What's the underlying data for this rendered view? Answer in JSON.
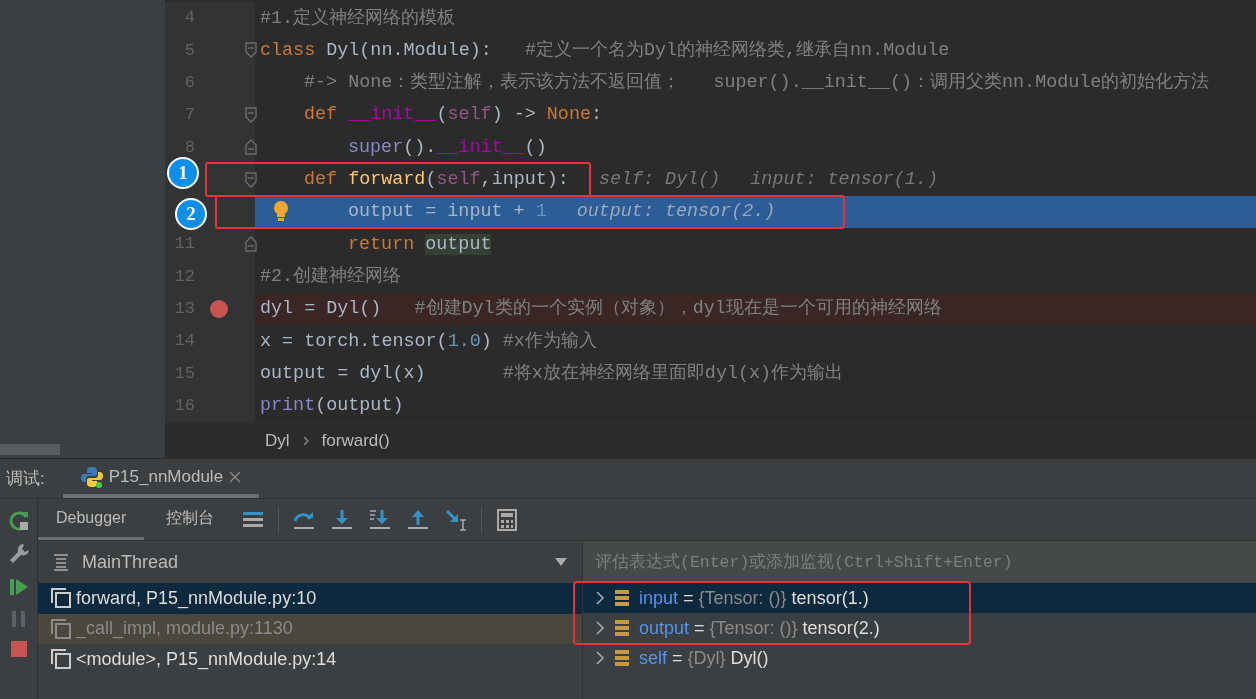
{
  "editor": {
    "lines": [
      {
        "number": "4",
        "kind": "outer",
        "current": false,
        "breakpoint": false,
        "fold_start": false,
        "fold_end": false,
        "tokens": [
          {
            "kind": "comment",
            "text": "#1.定义神经网络的模板"
          }
        ]
      },
      {
        "number": "5",
        "kind": "outer",
        "current": false,
        "breakpoint": false,
        "fold_start": true,
        "fold_end": false,
        "tokens": [
          {
            "kind": "keyword",
            "text": "class"
          },
          {
            "kind": "plain",
            "text": " Dyl(nn.Module):   "
          },
          {
            "kind": "comment",
            "text": "#定义一个名为Dyl的神经网络类,继承自nn.Module"
          }
        ]
      },
      {
        "number": "6",
        "kind": "inner",
        "current": false,
        "breakpoint": false,
        "fold_start": false,
        "fold_end": false,
        "tokens": [
          {
            "kind": "comment",
            "text": "#-> None：类型注解，表示该方法不返回值；   super().__init__()：调用父类nn.Module的初始化方法"
          }
        ]
      },
      {
        "number": "7",
        "kind": "inner",
        "current": false,
        "breakpoint": false,
        "fold_start": true,
        "fold_end": false,
        "tokens": [
          {
            "kind": "keyword",
            "text": "def"
          },
          {
            "kind": "magic",
            "text": " __init__"
          },
          {
            "kind": "plain",
            "text": "("
          },
          {
            "kind": "self",
            "text": "self"
          },
          {
            "kind": "plain",
            "text": ") -> "
          },
          {
            "kind": "keyword",
            "text": "None"
          },
          {
            "kind": "plain",
            "text": ":"
          }
        ]
      },
      {
        "number": "8",
        "kind": "innermost",
        "current": false,
        "breakpoint": false,
        "fold_start": false,
        "fold_end": true,
        "tokens": [
          {
            "kind": "builtin",
            "text": "super"
          },
          {
            "kind": "plain",
            "text": "()."
          },
          {
            "kind": "magic",
            "text": "__init__"
          },
          {
            "kind": "plain",
            "text": "()"
          }
        ]
      },
      {
        "kind": "inner",
        "current": false,
        "breakpoint": false,
        "fold_start": true,
        "fold_end": false,
        "badge": "1",
        "tokens": [
          {
            "kind": "keyword",
            "text": "def"
          },
          {
            "kind": "function",
            "text": " forward"
          },
          {
            "kind": "plain",
            "text": "("
          },
          {
            "kind": "self",
            "text": "self"
          },
          {
            "kind": "plain",
            "text": ",input):"
          }
        ],
        "hints": [
          "self: Dyl()",
          "input: tensor(1.)"
        ]
      },
      {
        "kind": "innermost",
        "current": true,
        "breakpoint": false,
        "fold_start": false,
        "fold_end": false,
        "bulb": true,
        "badge": "2",
        "tokens": [
          {
            "kind": "plain",
            "text": "output = input + "
          },
          {
            "kind": "number",
            "text": "1"
          }
        ],
        "hints": [
          "output: tensor(2.)"
        ]
      },
      {
        "number": "11",
        "kind": "innermost",
        "current": false,
        "breakpoint": false,
        "fold_start": false,
        "fold_end": true,
        "tokens": [
          {
            "kind": "keyword",
            "text": "return "
          },
          {
            "kind": "usage",
            "text": "output"
          }
        ]
      },
      {
        "number": "12",
        "kind": "outer",
        "current": false,
        "breakpoint": false,
        "fold_start": false,
        "fold_end": false,
        "tokens": [
          {
            "kind": "comment",
            "text": "#2.创建神经网络"
          }
        ]
      },
      {
        "number": "13",
        "kind": "outer",
        "current": false,
        "breakpoint": true,
        "fold_start": false,
        "fold_end": false,
        "tokens": [
          {
            "kind": "plain",
            "text": "dyl = Dyl()   "
          },
          {
            "kind": "comment",
            "text": "#创建Dyl类的一个实例（对象），dyl现在是一个可用的神经网络"
          }
        ]
      },
      {
        "number": "14",
        "kind": "outer",
        "current": false,
        "breakpoint": false,
        "fold_start": false,
        "fold_end": false,
        "tokens": [
          {
            "kind": "plain",
            "text": "x = torch.tensor("
          },
          {
            "kind": "number",
            "text": "1.0"
          },
          {
            "kind": "plain",
            "text": ")"
          },
          {
            "kind": "comment",
            "text": " #x作为输入"
          }
        ]
      },
      {
        "number": "15",
        "kind": "outer",
        "current": false,
        "breakpoint": false,
        "fold_start": false,
        "fold_end": false,
        "tokens": [
          {
            "kind": "plain",
            "text": "output = dyl(x)       "
          },
          {
            "kind": "comment",
            "text": "#将x放在神经网络里面即dyl(x)作为输出"
          }
        ]
      },
      {
        "number": "16",
        "kind": "outer",
        "current": false,
        "breakpoint": false,
        "fold_start": false,
        "fold_end": false,
        "tokens": [
          {
            "kind": "builtin",
            "text": "print"
          },
          {
            "kind": "plain",
            "text": "(output)"
          }
        ]
      }
    ],
    "breadcrumb": [
      "Dyl",
      "forward()"
    ]
  },
  "debug": {
    "label": "调试:",
    "session_tab": "P15_nnModule",
    "tabs": [
      {
        "label": "Debugger",
        "selected": true
      },
      {
        "label": "控制台",
        "selected": false
      }
    ],
    "thread": "MainThread",
    "frames": [
      {
        "text": "forward, P15_nnModule.py:10",
        "selected": true,
        "library": false
      },
      {
        "text": "_call_impl, module.py:1130",
        "selected": false,
        "library": true
      },
      {
        "text": "<module>, P15_nnModule.py:14",
        "selected": false,
        "library": false
      }
    ],
    "eval_placeholder": "评估表达式(Enter)或添加监视(Ctrl+Shift+Enter)",
    "variables": [
      {
        "name": "input",
        "sep": "=",
        "type": "{Tensor: ()}",
        "value": "tensor(1.)",
        "selected": true,
        "framed": true
      },
      {
        "name": "output",
        "sep": "=",
        "type": "{Tensor: ()}",
        "value": "tensor(2.)",
        "selected": false,
        "framed": true
      },
      {
        "name": "self",
        "sep": "=",
        "type": "{Dyl}",
        "value": "Dyl()",
        "selected": false,
        "framed": false
      }
    ]
  }
}
